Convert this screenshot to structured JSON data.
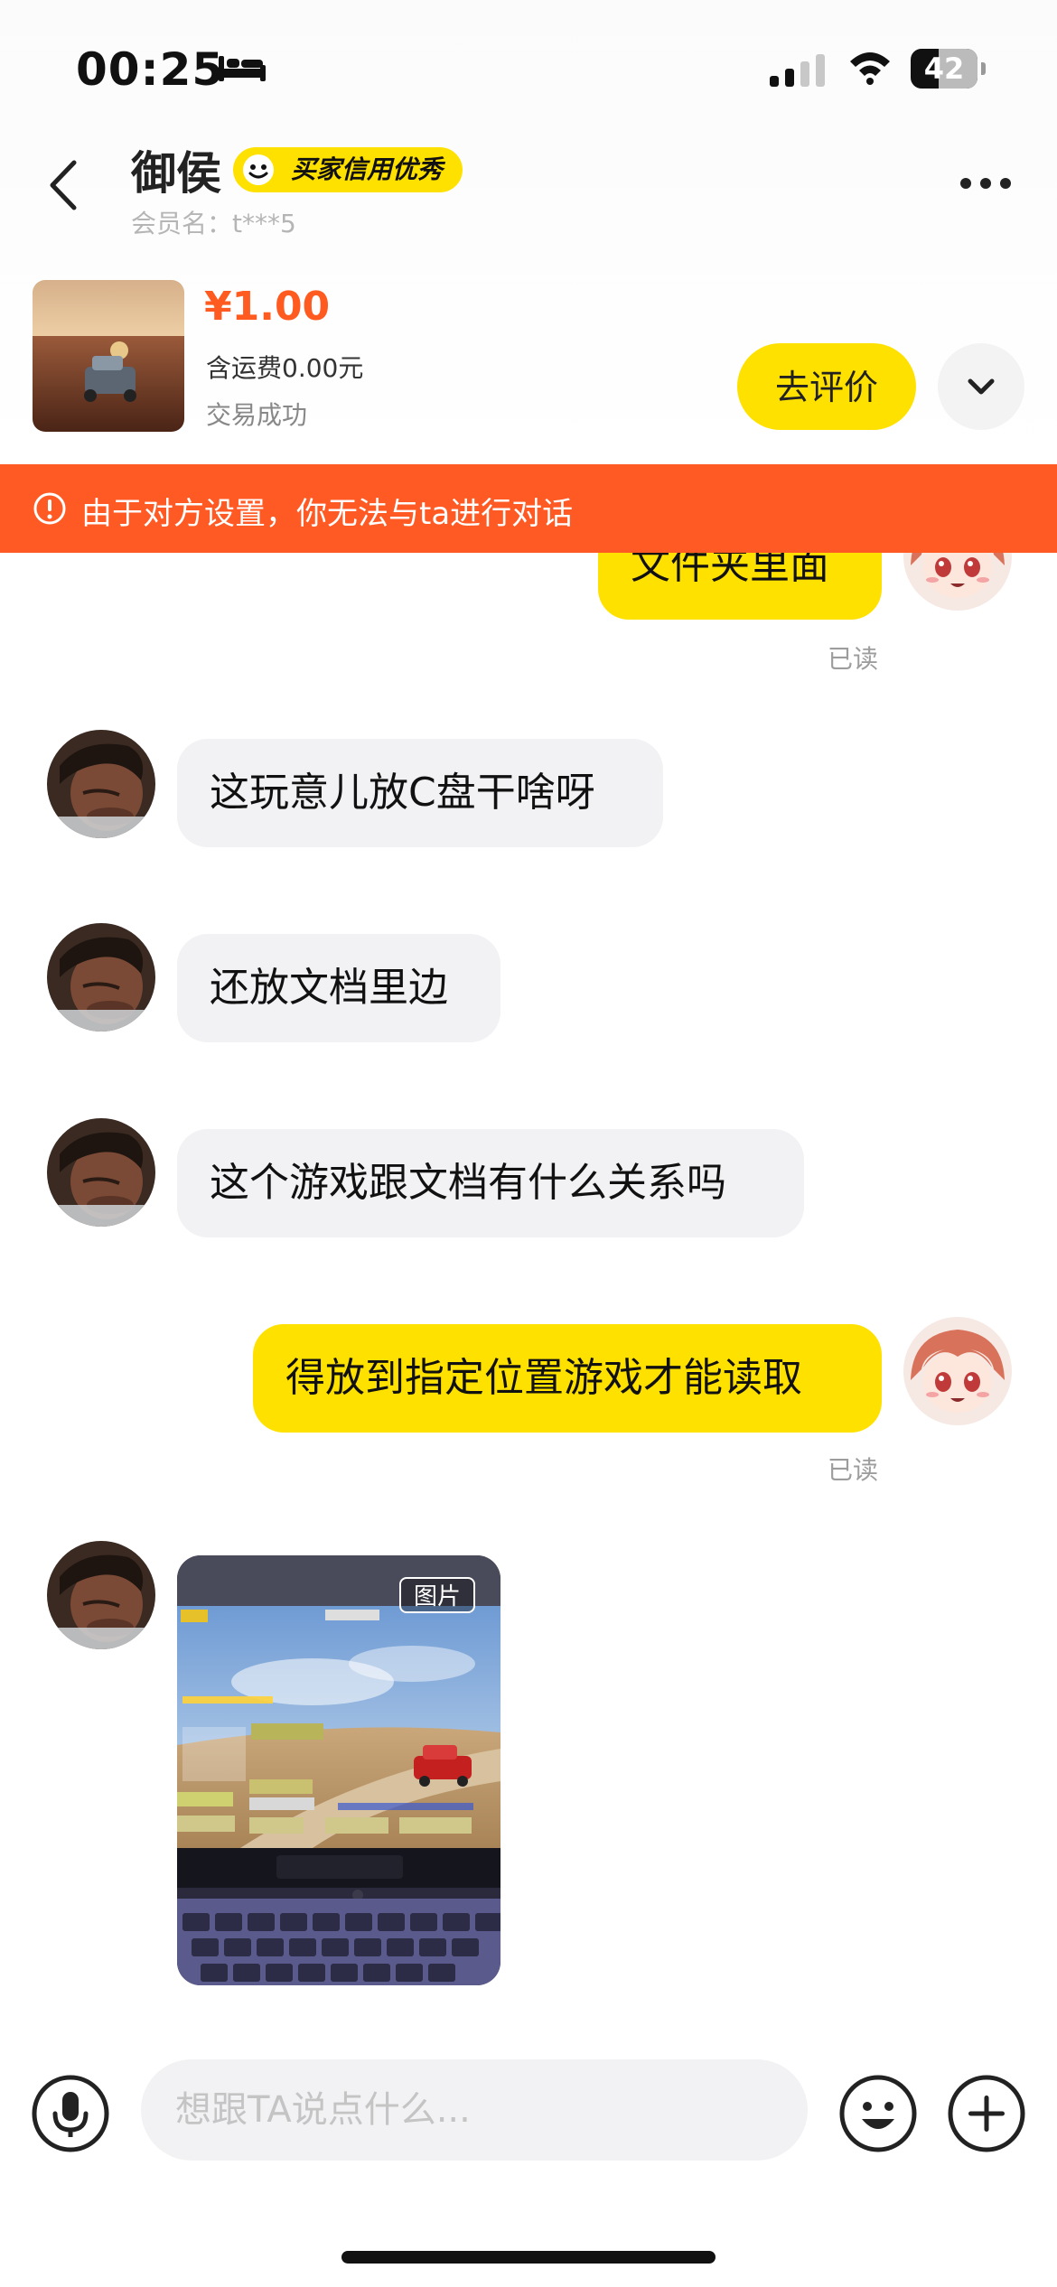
{
  "status_bar": {
    "time": "00:25",
    "battery": "42",
    "battery_level_percent": 42
  },
  "header": {
    "seller_name": "御侯",
    "badge": "买家信用优秀",
    "member_label": "会员名：t***5",
    "back_icon": "chevron-left-icon",
    "more_icon": "ellipsis-icon"
  },
  "product": {
    "price": "¥1.00",
    "shipping": "含运费0.00元",
    "status": "交易成功",
    "review_button": "去评价"
  },
  "banner": {
    "text": "由于对方设置，你无法与ta进行对话",
    "color": "#ff5a24"
  },
  "messages": [
    {
      "direction": "out",
      "text": "文件夹里面",
      "read": "已读"
    },
    {
      "direction": "in",
      "text": "这玩意儿放C盘干啥呀"
    },
    {
      "direction": "in",
      "text": "还放文档里边"
    },
    {
      "direction": "in",
      "text": "这个游戏跟文档有什么关系吗"
    },
    {
      "direction": "out",
      "text": "得放到指定位置游戏才能读取",
      "read": "已读"
    },
    {
      "direction": "in",
      "type": "image",
      "tag": "图片"
    }
  ],
  "input": {
    "placeholder": "想跟TA说点什么..."
  },
  "colors": {
    "accent_yellow": "#ffe100",
    "price_orange": "#ff5a1f",
    "incoming_bubble": "#f2f2f4"
  }
}
